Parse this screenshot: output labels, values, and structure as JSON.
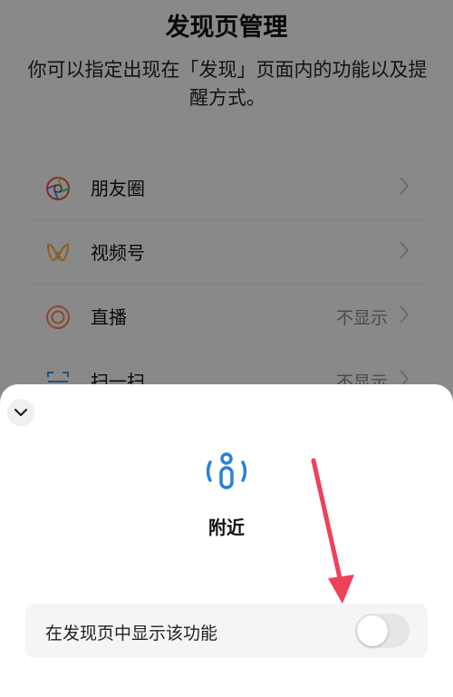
{
  "page": {
    "title": "发现页管理",
    "description": "你可以指定出现在「发现」页面内的功能以及提醒方式。"
  },
  "list": [
    {
      "label": "朋友圈",
      "value": "",
      "icon": "moments-icon"
    },
    {
      "label": "视频号",
      "value": "",
      "icon": "channels-icon"
    },
    {
      "label": "直播",
      "value": "不显示",
      "icon": "live-icon"
    },
    {
      "label": "扫一扫",
      "value": "不显示",
      "icon": "scan-icon"
    }
  ],
  "sheet": {
    "feature_name": "附近",
    "feature_icon": "nearby-icon",
    "setting_label": "在发现页中显示该功能",
    "toggle_on": false
  },
  "colors": {
    "accent_blue": "#2a80d8",
    "annotation_arrow": "#f0405a",
    "live_orange": "#f07a52",
    "channels_orange": "#f0a040"
  }
}
